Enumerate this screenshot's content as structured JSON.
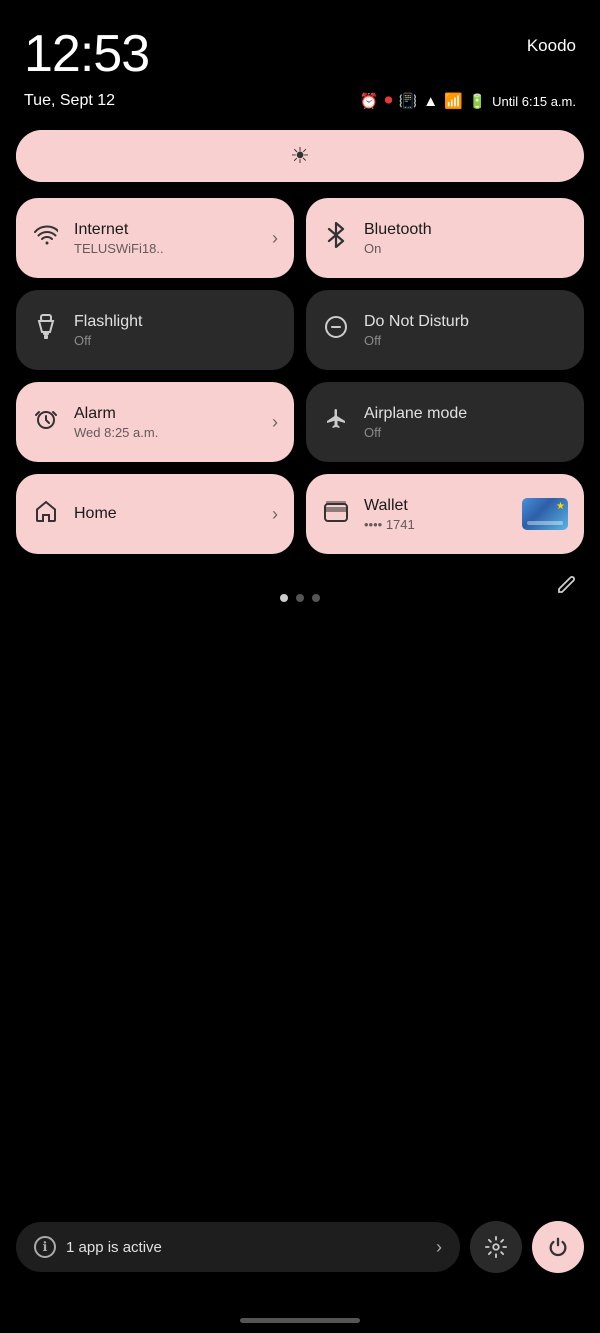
{
  "statusBar": {
    "time": "12:53",
    "carrier": "Koodo",
    "date": "Tue, Sept 12",
    "batteryText": "Until 6:15 a.m."
  },
  "brightness": {
    "icon": "☀"
  },
  "tiles": [
    {
      "id": "internet",
      "active": true,
      "icon": "wifi",
      "title": "Internet",
      "subtitle": "TELUSWiFi18..",
      "hasChevron": true
    },
    {
      "id": "bluetooth",
      "active": true,
      "icon": "bluetooth",
      "title": "Bluetooth",
      "subtitle": "On",
      "hasChevron": false
    },
    {
      "id": "flashlight",
      "active": false,
      "icon": "flashlight",
      "title": "Flashlight",
      "subtitle": "Off",
      "hasChevron": false
    },
    {
      "id": "donotdisturb",
      "active": false,
      "icon": "dnd",
      "title": "Do Not Disturb",
      "subtitle": "Off",
      "hasChevron": false
    },
    {
      "id": "alarm",
      "active": true,
      "icon": "alarm",
      "title": "Alarm",
      "subtitle": "Wed 8:25 a.m.",
      "hasChevron": true
    },
    {
      "id": "airplane",
      "active": false,
      "icon": "airplane",
      "title": "Airplane mode",
      "subtitle": "Off",
      "hasChevron": false
    },
    {
      "id": "home",
      "active": true,
      "icon": "home",
      "title": "Home",
      "subtitle": "",
      "hasChevron": true
    },
    {
      "id": "wallet",
      "active": true,
      "icon": "wallet",
      "title": "Wallet",
      "subtitle": "•••• 1741",
      "hasChevron": false
    }
  ],
  "pagination": {
    "dots": [
      true,
      false,
      false
    ]
  },
  "bottomBar": {
    "activeAppText": "1 app is active",
    "settingsIcon": "⚙",
    "powerIcon": "⏻"
  }
}
